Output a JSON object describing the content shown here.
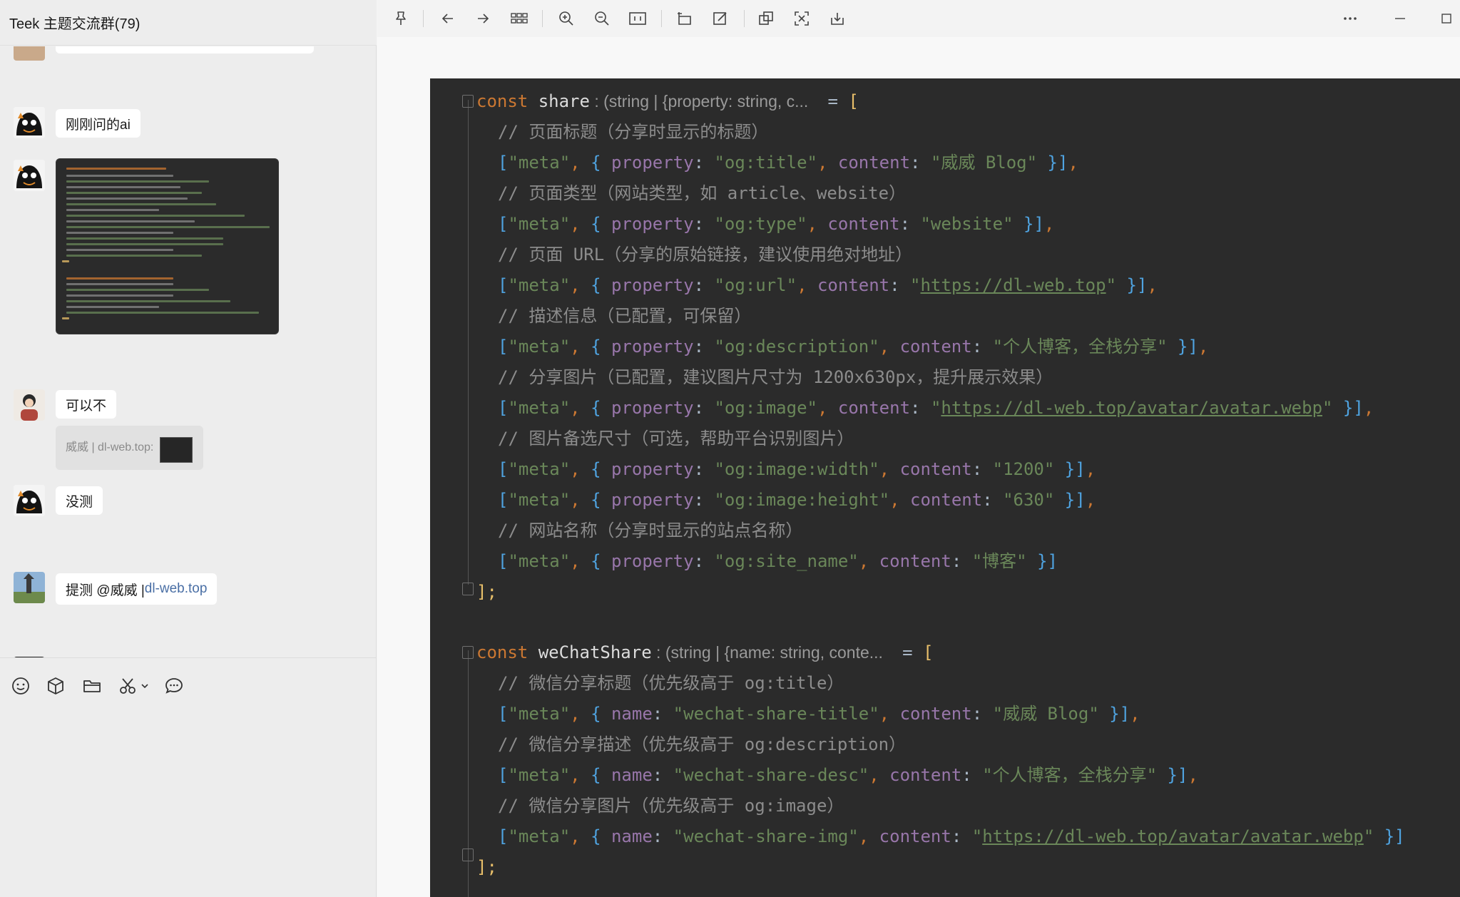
{
  "chat": {
    "title": "Teek 主题交流群(79)",
    "messages": [
      {
        "text": "刚刚问的ai"
      },
      {
        "text": "可以不",
        "quote": "威威 | dl-web.top:"
      },
      {
        "text": "没测"
      },
      {
        "text_prefix": "提测 @威威 | ",
        "link": "dl-web.top"
      }
    ]
  },
  "composer": {
    "tools": [
      "emoji-icon",
      "box-icon",
      "folder-icon",
      "scissors-icon",
      "chevron-down-icon",
      "chat-bubble-icon"
    ]
  },
  "viewer": {
    "toolbar": [
      "pin-icon",
      "back-arrow-icon",
      "forward-arrow-icon",
      "grid-icon",
      "zoom-in-icon",
      "zoom-out-icon",
      "fit-icon",
      "rotate-icon",
      "edit-icon",
      "copy-icon",
      "scan-icon",
      "download-icon",
      "more-icon",
      "minimize-icon",
      "maximize-icon"
    ],
    "code": {
      "share_decl": {
        "keyword": "const",
        "name": "share",
        "hint": ": (string | {property: string, c...",
        "eq": "= ["
      },
      "share_lines": [
        {
          "type": "comment",
          "text": "// 页面标题（分享时显示的标题）"
        },
        {
          "type": "meta",
          "key": "property",
          "prop": "\"og:title\"",
          "content": "\"威威 Blog\"",
          "end": " }],"
        },
        {
          "type": "comment",
          "text": "// 页面类型（网站类型，如 article、website）"
        },
        {
          "type": "meta",
          "key": "property",
          "prop": "\"og:type\"",
          "content": "\"website\"",
          "end": " }],"
        },
        {
          "type": "comment",
          "text": "// 页面 URL（分享的原始链接，建议使用绝对地址）"
        },
        {
          "type": "meta-url",
          "key": "property",
          "prop": "\"og:url\"",
          "url": "https://dl-web.top",
          "end": " }],"
        },
        {
          "type": "comment",
          "text": "// 描述信息（已配置，可保留）"
        },
        {
          "type": "meta",
          "key": "property",
          "prop": "\"og:description\"",
          "content": "\"个人博客，全栈分享\"",
          "end": " }],"
        },
        {
          "type": "comment",
          "text": "// 分享图片（已配置，建议图片尺寸为 1200x630px，提升展示效果）"
        },
        {
          "type": "meta-url",
          "key": "property",
          "prop": "\"og:image\"",
          "url": "https://dl-web.top/avatar/avatar.webp",
          "end": " }],"
        },
        {
          "type": "comment",
          "text": "// 图片备选尺寸（可选，帮助平台识别图片）"
        },
        {
          "type": "meta",
          "key": "property",
          "prop": "\"og:image:width\"",
          "content": "\"1200\"",
          "end": " }],"
        },
        {
          "type": "meta",
          "key": "property",
          "prop": "\"og:image:height\"",
          "content": "\"630\"",
          "end": " }],"
        },
        {
          "type": "comment",
          "text": "// 网站名称（分享时显示的站点名称）"
        },
        {
          "type": "meta",
          "key": "property",
          "prop": "\"og:site_name\"",
          "content": "\"博客\"",
          "end": " }]"
        }
      ],
      "share_close": "];",
      "wechat_decl": {
        "keyword": "const",
        "name": "weChatShare",
        "hint": ": (string | {name: string, conte...",
        "eq": "= ["
      },
      "wechat_lines": [
        {
          "type": "comment",
          "text": "// 微信分享标题（优先级高于 og:title）"
        },
        {
          "type": "meta",
          "key": "name",
          "prop": "\"wechat-share-title\"",
          "content": "\"威威 Blog\"",
          "end": " }],"
        },
        {
          "type": "comment",
          "text": "// 微信分享描述（优先级高于 og:description）"
        },
        {
          "type": "meta",
          "key": "name",
          "prop": "\"wechat-share-desc\"",
          "content": "\"个人博客，全栈分享\"",
          "end": " }],"
        },
        {
          "type": "comment",
          "text": "// 微信分享图片（优先级高于 og:image）"
        },
        {
          "type": "meta-url",
          "key": "name",
          "prop": "\"wechat-share-img\"",
          "url": "https://dl-web.top/avatar/avatar.webp",
          "end": " }]"
        }
      ],
      "wechat_close": "];"
    }
  }
}
